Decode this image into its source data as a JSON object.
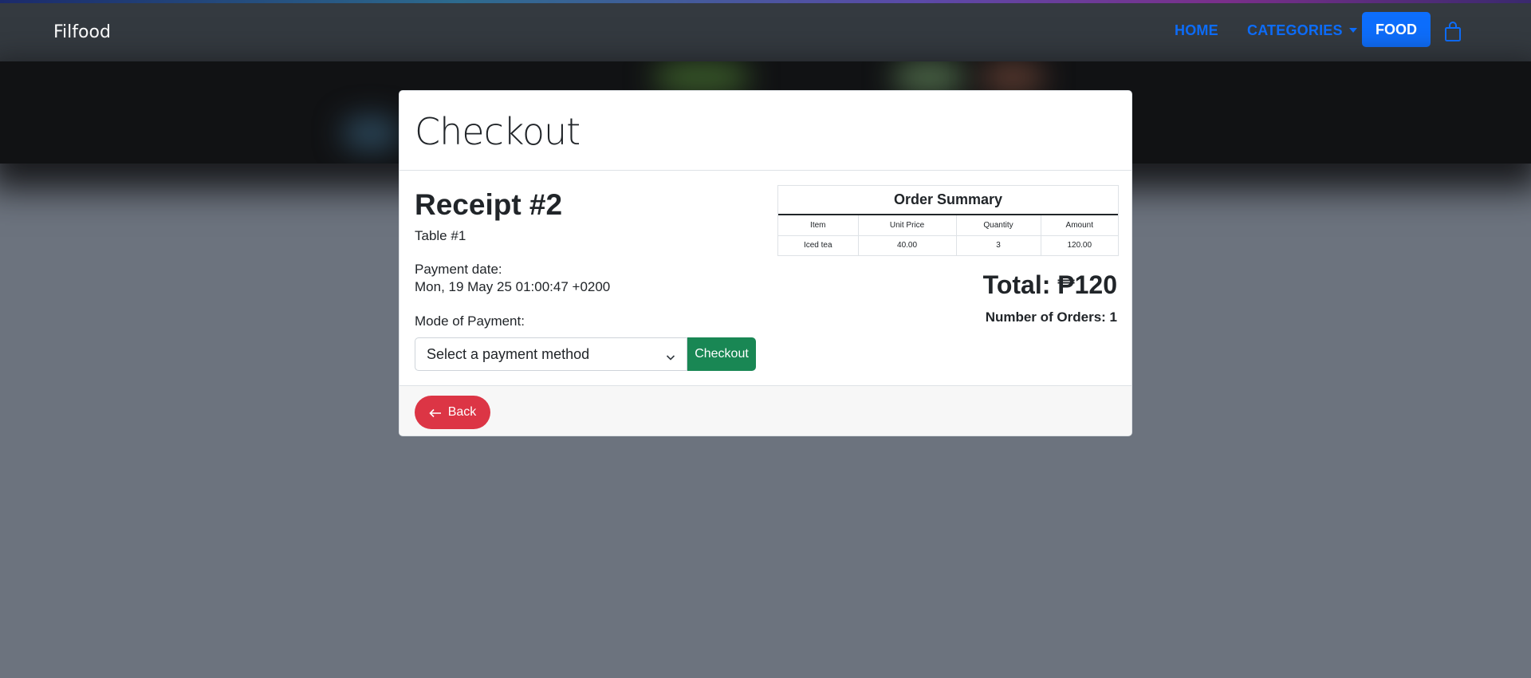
{
  "navbar": {
    "brand": "Filfood",
    "links": {
      "home": "HOME",
      "categories": "CATEGORIES",
      "food": "FOOD"
    },
    "cart_icon": "shopping-bag-icon"
  },
  "card": {
    "title": "Checkout",
    "receipt_title": "Receipt #2",
    "table_no": "Table #1",
    "payment_date_label": "Payment date:",
    "payment_date_value": "Mon, 19 May 25 01:00:47 +0200",
    "mode_of_payment_label": "Mode of Payment:",
    "payment_select": {
      "selected": "Select a payment method"
    },
    "checkout_button": "Checkout",
    "order_summary": {
      "title": "Order Summary",
      "headers": [
        "Item",
        "Unit Price",
        "Quantity",
        "Amount"
      ],
      "rows": [
        [
          "Iced tea",
          "40.00",
          "3",
          "120.00"
        ]
      ]
    },
    "total": "Total: ₱120",
    "number_of_orders": "Number of Orders: 1",
    "back_button": "Back"
  },
  "colors": {
    "navbar_bg": "#343a40",
    "link_blue": "#0d6efd",
    "checkout_green": "#198754",
    "back_red": "#dc3545",
    "page_bg": "#6c737e"
  }
}
